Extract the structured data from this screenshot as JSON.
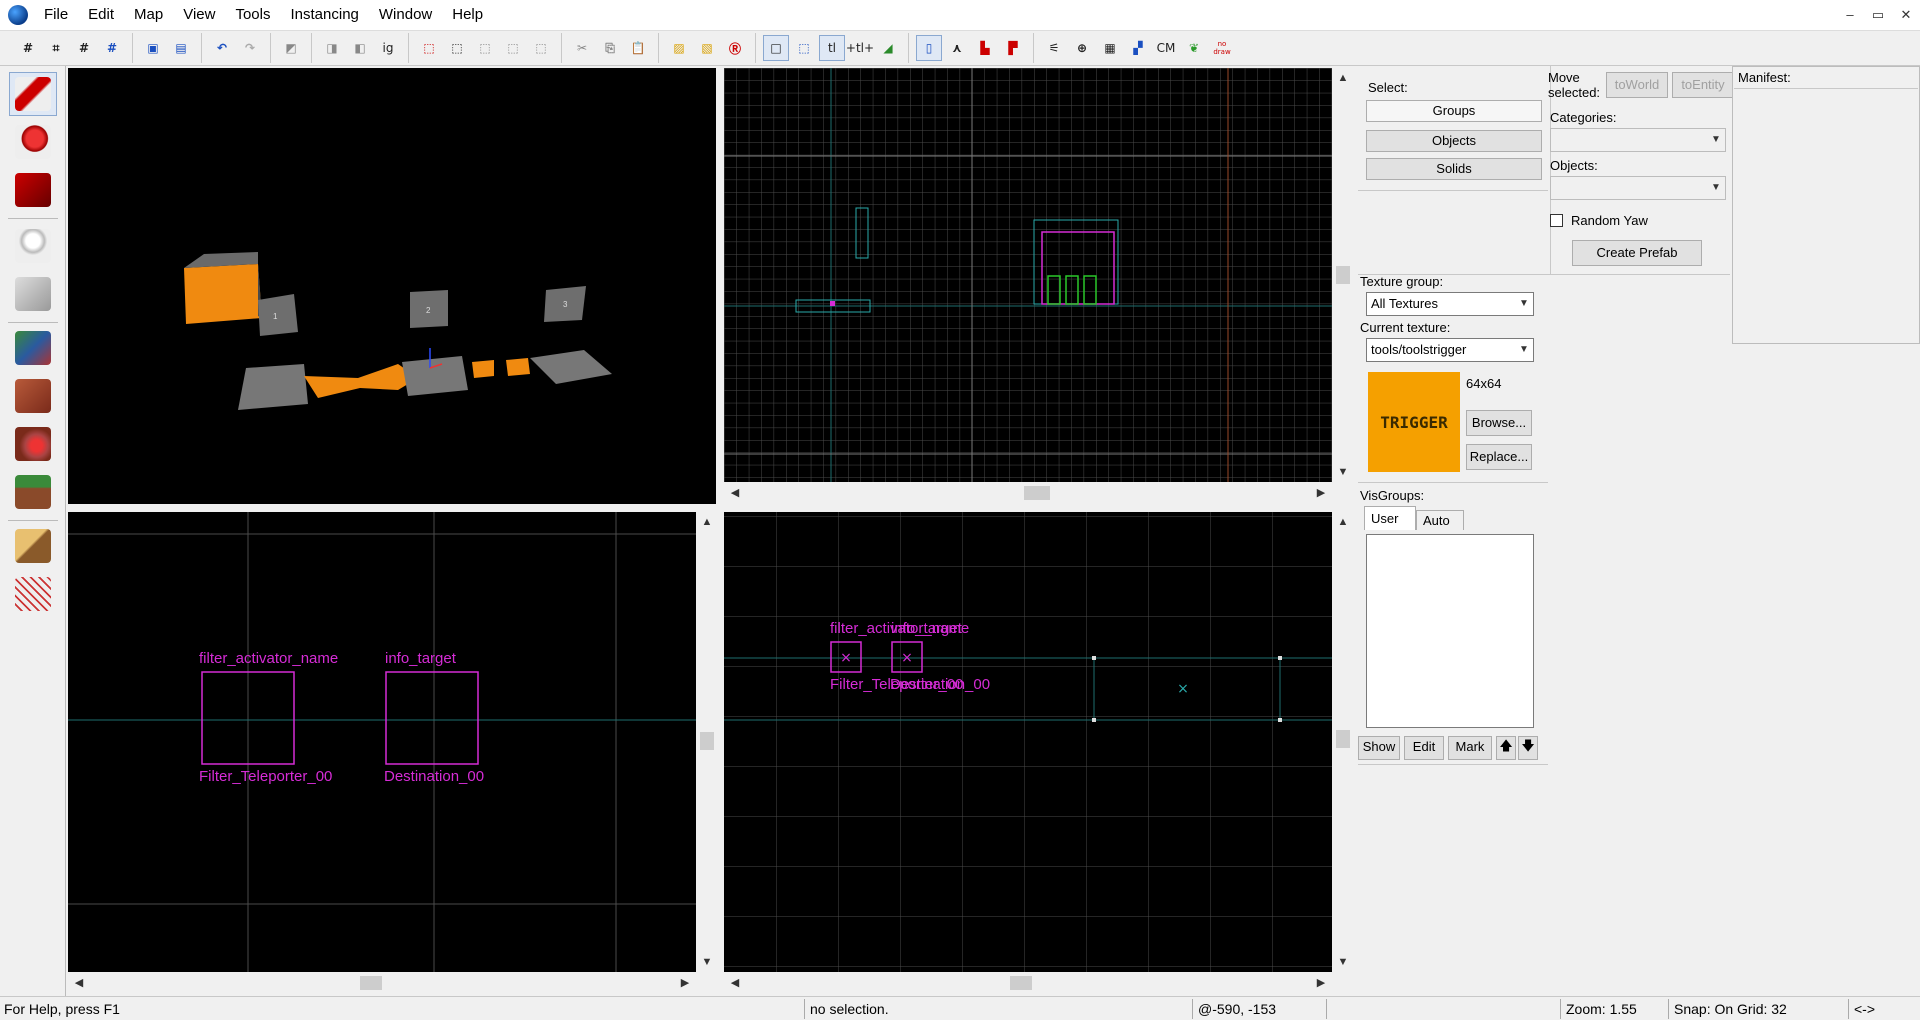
{
  "menubar": {
    "items": [
      "File",
      "Edit",
      "Map",
      "View",
      "Tools",
      "Instancing",
      "Window",
      "Help"
    ],
    "window_controls": [
      "–",
      "▭",
      "✕"
    ]
  },
  "toolbar": {
    "texts": {
      "tl": "tl",
      "tl2": "+tl+",
      "ig": "ig",
      "cm": "CM",
      "nodraw": "no draw"
    }
  },
  "viewport_topleft": {
    "labels": [
      "1",
      "2",
      "3"
    ]
  },
  "viewport_bottomleft": {
    "labels": [
      "filter_activator_name",
      "info_target",
      "Filter_Teleporter_00",
      "Destination_00"
    ]
  },
  "viewport_bottomright": {
    "labels": [
      "filter_activator_name",
      "info_target",
      "Filter_Teleporter_00",
      "Destination_00"
    ]
  },
  "panel": {
    "select_label": "Select:",
    "select_buttons": [
      "Groups",
      "Objects",
      "Solids"
    ],
    "move_selected_label": "Move selected:",
    "to_world": "toWorld",
    "to_entity": "toEntity",
    "manifest_label": "Manifest:",
    "categories_label": "Categories:",
    "objects_label": "Objects:",
    "random_yaw": "Random Yaw",
    "create_prefab": "Create Prefab",
    "texture_group_label": "Texture group:",
    "texture_group_value": "All Textures",
    "current_texture_label": "Current texture:",
    "current_texture_value": "tools/toolstrigger",
    "texture_size": "64x64",
    "texture_preview_text": "TRIGGER",
    "browse": "Browse...",
    "replace": "Replace...",
    "visgroups_label": "VisGroups:",
    "visgroup_tabs": [
      "User",
      "Auto"
    ],
    "visgroup_buttons": [
      "Show",
      "Edit",
      "Mark",
      "🡅",
      "🡇"
    ]
  },
  "status": {
    "help": "For Help, press F1",
    "selection": "no selection.",
    "coords": "@-590, -153",
    "zoom": "Zoom: 1.55",
    "snap": "Snap: On Grid: 32",
    "extra": "<->"
  },
  "colors": {
    "entity_magenta": "#d62cd6",
    "trigger_orange": "#f5a000",
    "brush_gray": "#6e6e6e"
  }
}
